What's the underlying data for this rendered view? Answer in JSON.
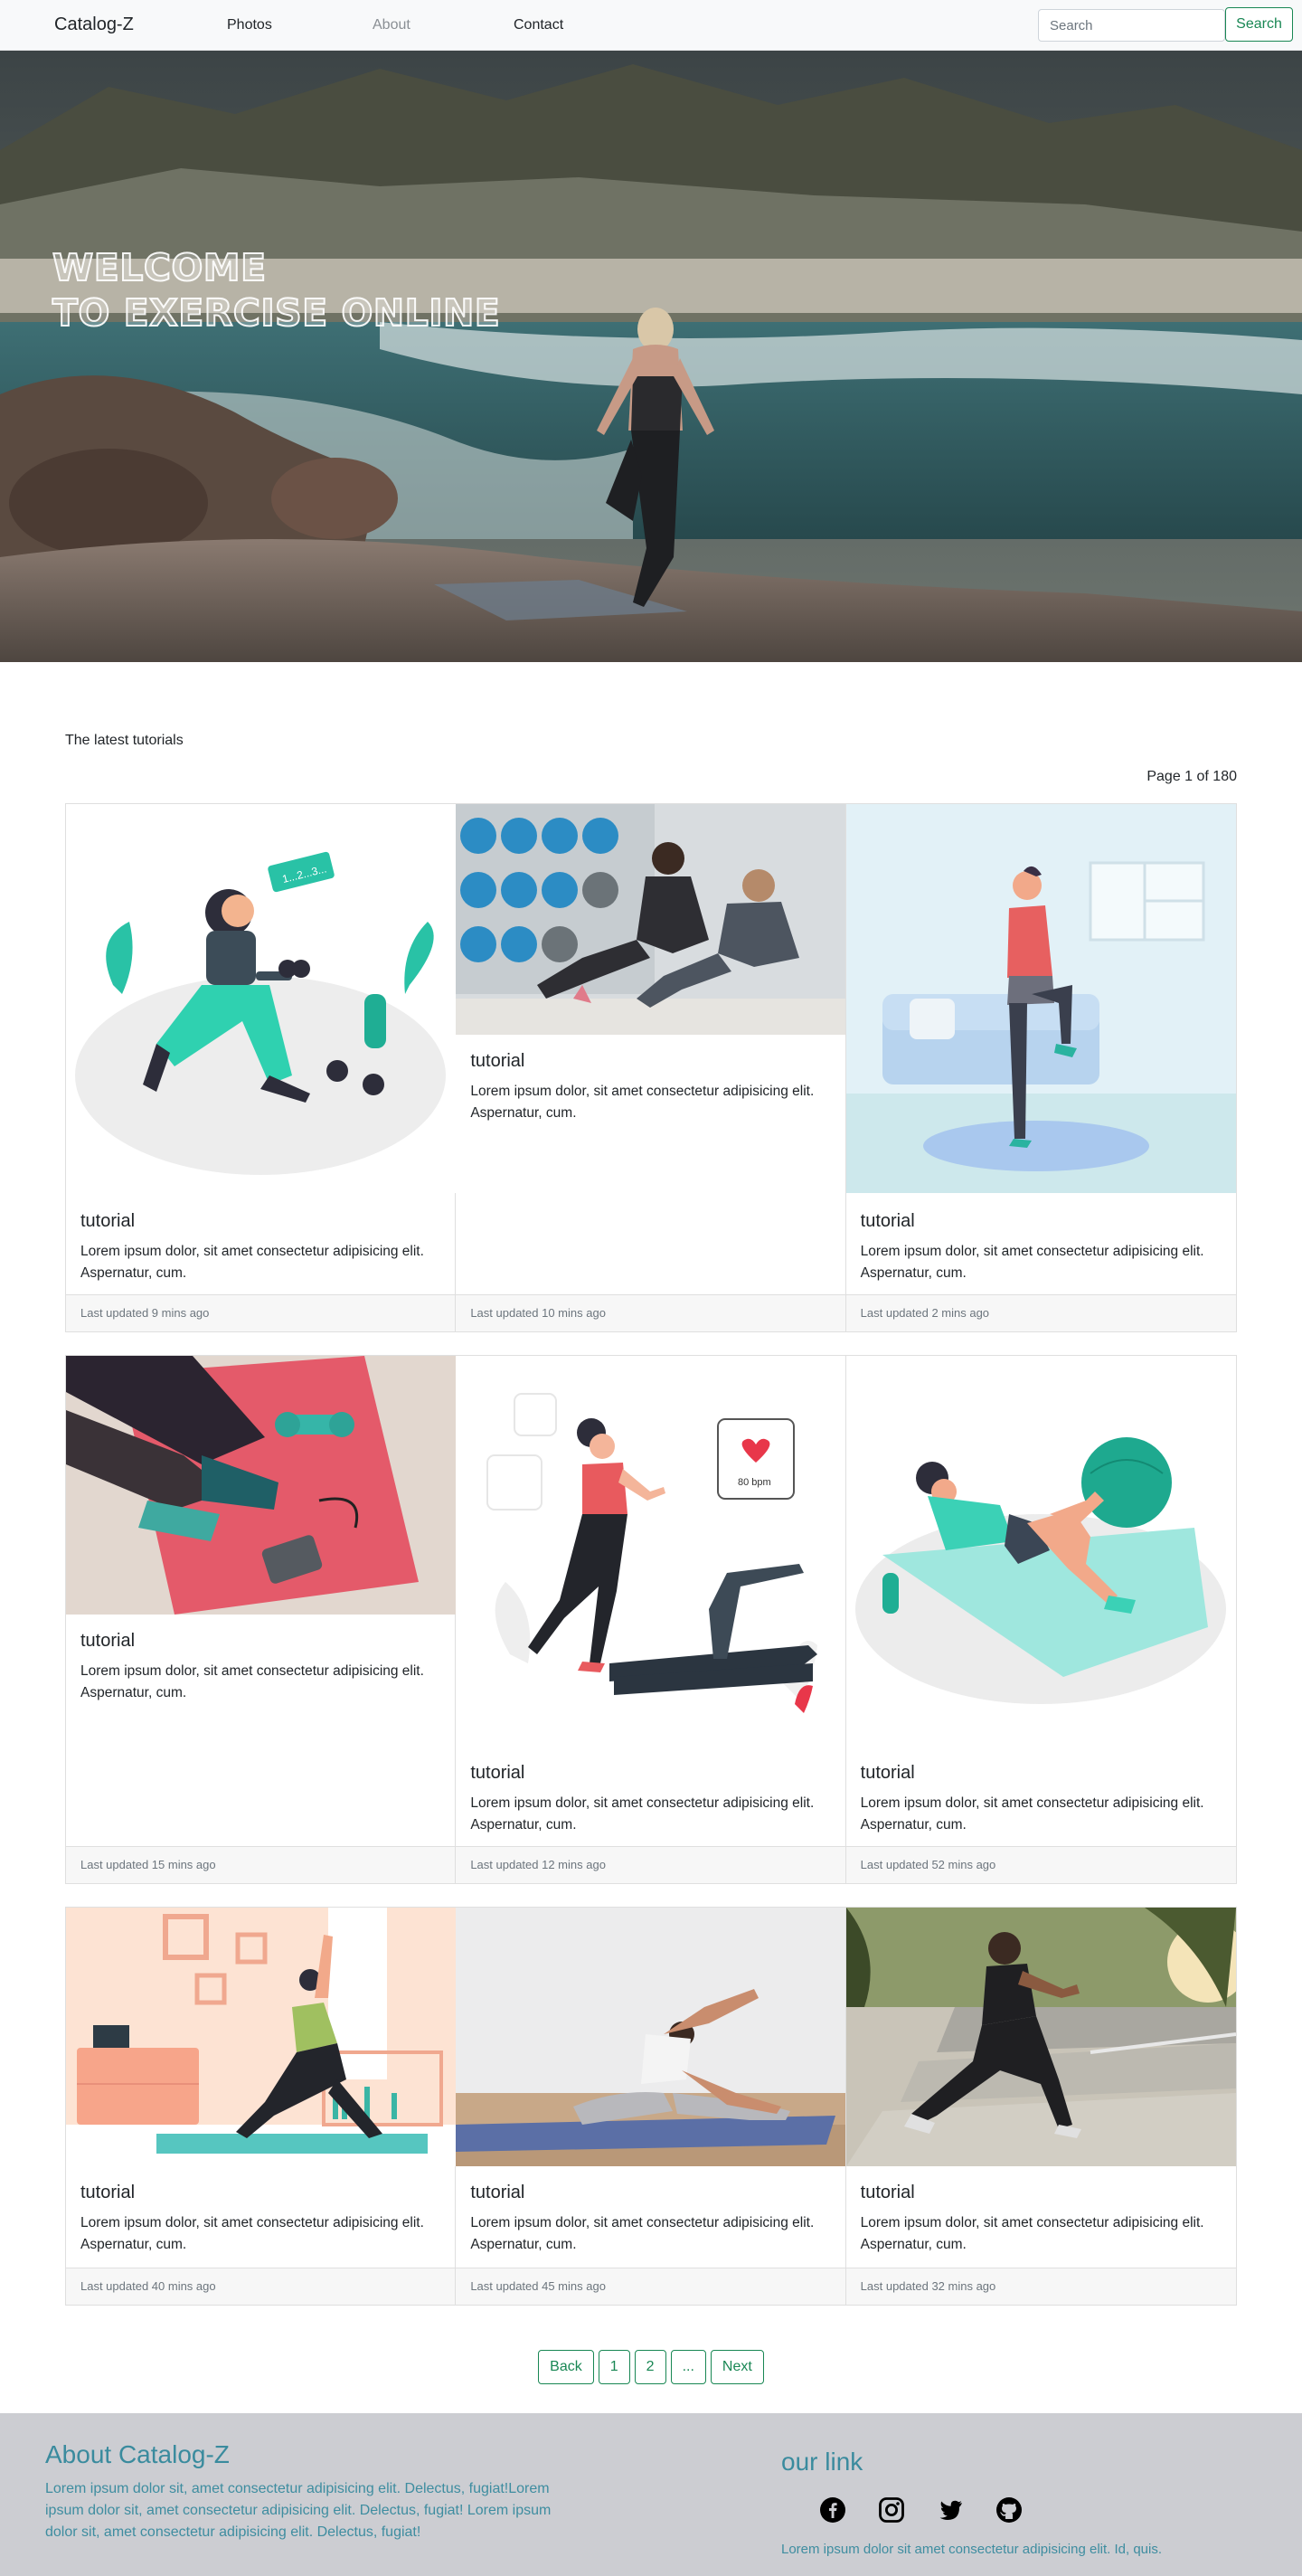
{
  "navbar": {
    "brand": "Catalog-Z",
    "links": [
      "Photos",
      "About",
      "Contact"
    ],
    "search_placeholder": "Search",
    "search_button": "Search"
  },
  "hero": {
    "title_line1": "Welcome",
    "title_line2": "to Exercise online"
  },
  "main": {
    "section_label": "The latest tutorials",
    "page_info": "Page 1 of 180",
    "cards": [
      {
        "title": "tutorial",
        "text": "Lorem ipsum dolor, sit amet consectetur adipisicing elit. Aspernatur, cum.",
        "updated": "Last updated 9 mins ago"
      },
      {
        "title": "tutorial",
        "text": "Lorem ipsum dolor, sit amet consectetur adipisicing elit. Aspernatur, cum.",
        "updated": "Last updated 10 mins ago"
      },
      {
        "title": "tutorial",
        "text": "Lorem ipsum dolor, sit amet consectetur adipisicing elit. Aspernatur, cum.",
        "updated": "Last updated 2 mins ago"
      },
      {
        "title": "tutorial",
        "text": "Lorem ipsum dolor, sit amet consectetur adipisicing elit. Aspernatur, cum.",
        "updated": "Last updated 15 mins ago"
      },
      {
        "title": "tutorial",
        "text": "Lorem ipsum dolor, sit amet consectetur adipisicing elit. Aspernatur, cum.",
        "updated": "Last updated 12 mins ago"
      },
      {
        "title": "tutorial",
        "text": "Lorem ipsum dolor, sit amet consectetur adipisicing elit. Aspernatur, cum.",
        "updated": "Last updated 52 mins ago"
      },
      {
        "title": "tutorial",
        "text": "Lorem ipsum dolor, sit amet consectetur adipisicing elit. Aspernatur, cum.",
        "updated": "Last updated 40 mins ago"
      },
      {
        "title": "tutorial",
        "text": "Lorem ipsum dolor, sit amet consectetur adipisicing elit. Aspernatur, cum.",
        "updated": "Last updated 45 mins ago"
      },
      {
        "title": "tutorial",
        "text": "Lorem ipsum dolor, sit amet consectetur adipisicing elit. Aspernatur, cum.",
        "updated": "Last updated 32 mins ago"
      }
    ]
  },
  "pagination": {
    "back": "Back",
    "page1": "1",
    "page2": "2",
    "ellipsis": "...",
    "next": "Next"
  },
  "footer": {
    "about_title": "About Catalog-Z",
    "about_text": "Lorem ipsum dolor sit, amet consectetur adipisicing elit. Delectus, fugiat!Lorem ipsum dolor sit, amet consectetur adipisicing elit. Delectus, fugiat! Lorem ipsum dolor sit, amet consectetur adipisicing elit. Delectus, fugiat!",
    "link_title": "our link",
    "social_icons": [
      "facebook-icon",
      "instagram-icon",
      "twitter-icon",
      "github-icon"
    ],
    "link_text": "Lorem ipsum dolor sit amet consectetur adipisicing elit. Id, quis."
  },
  "colors": {
    "accent": "#198754",
    "footer_bg": "#cccdd2",
    "footer_text": "#3a8b9e"
  }
}
